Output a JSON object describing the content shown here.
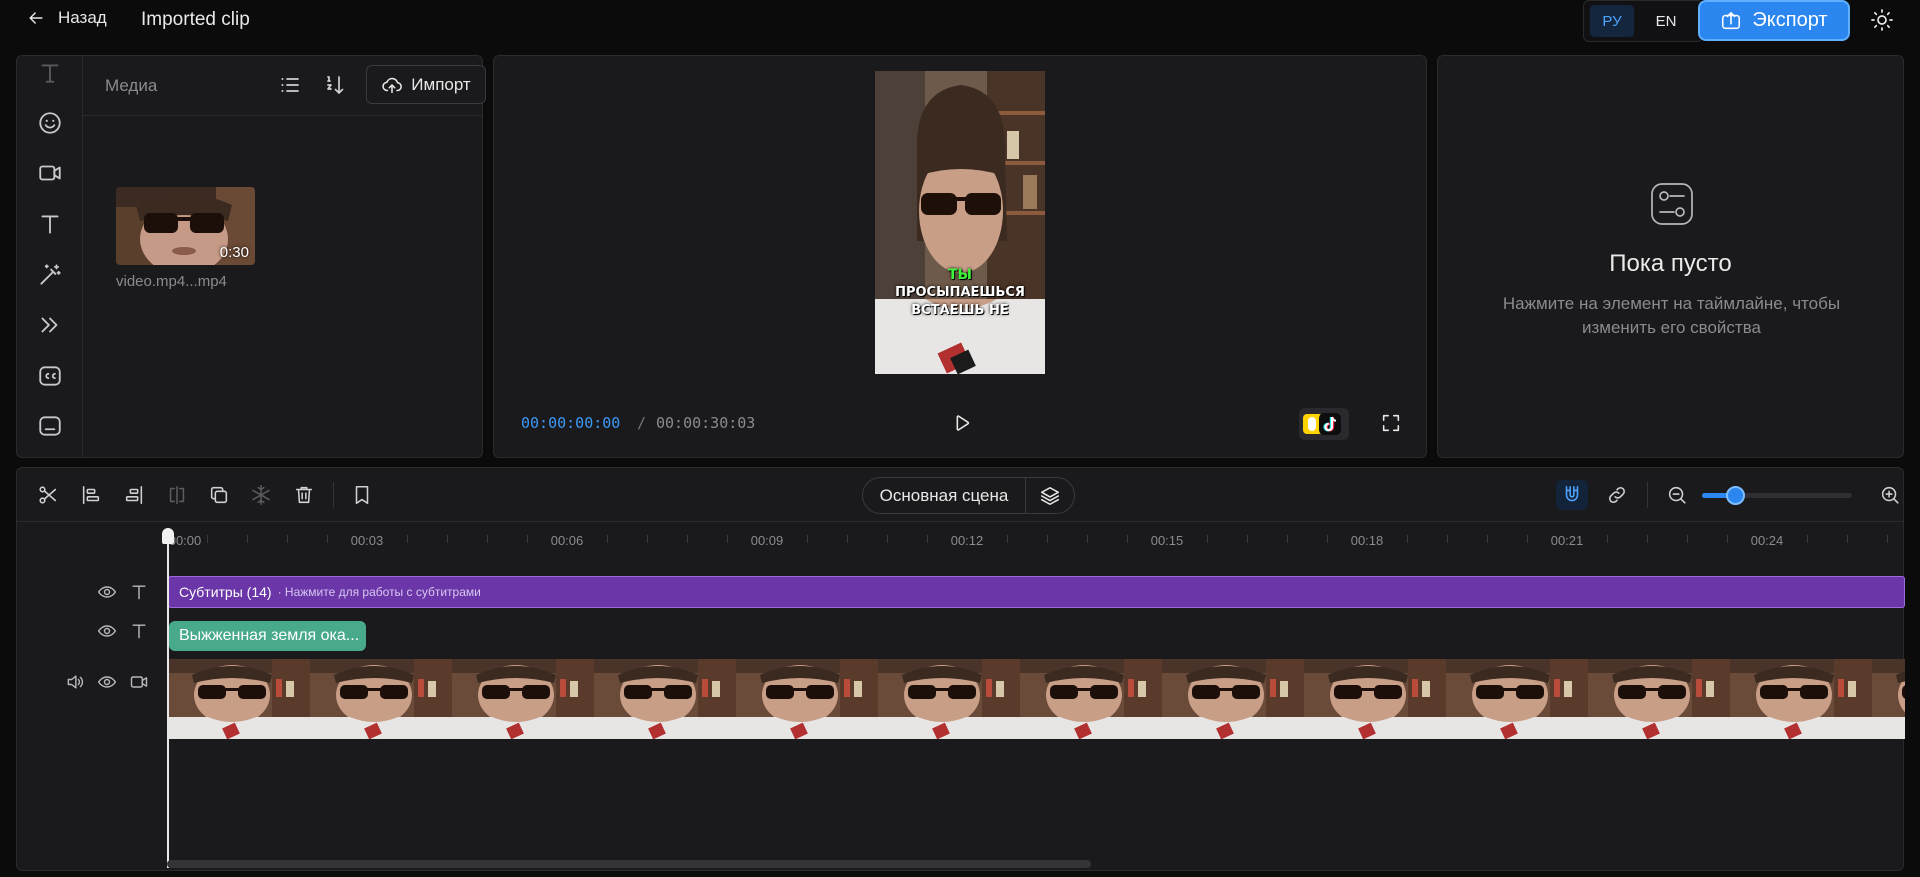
{
  "header": {
    "back_label": "Назад",
    "project_title": "Imported clip",
    "languages": [
      {
        "code": "РУ",
        "active": true
      },
      {
        "code": "EN",
        "active": false
      }
    ],
    "export_label": "Экспорт"
  },
  "media_panel": {
    "title": "Медиа",
    "import_label": "Импорт",
    "items": [
      {
        "name": "video.mp4...mp4",
        "duration": "0:30"
      }
    ]
  },
  "preview": {
    "caption_highlight": "ТЫ",
    "caption_line1": "ПРОСЫПАЕШЬСЯ",
    "caption_line2": "ВСТАЕШЬ НЕ",
    "current_time": "00:00:00:00",
    "separator": "/",
    "total_time": "00:00:30:03"
  },
  "properties": {
    "title": "Пока пусто",
    "hint": "Нажмите на элемент на таймлайне, чтобы изменить его свойства"
  },
  "timeline": {
    "scene_name": "Основная сцена",
    "zoom_level": 0.22,
    "ruler_labels": [
      "00:00",
      "00:03",
      "00:06",
      "00:09",
      "00:12",
      "00:15",
      "00:18",
      "00:21",
      "00:24"
    ],
    "subtitle_track": {
      "title": "Субтитры (14)",
      "hint": "· Нажмите для работы с субтитрами"
    },
    "text_clip": "Выжженная земля ока..."
  },
  "colors": {
    "accent": "#2b86ef",
    "subtitle_track": "#6a36a8",
    "text_clip": "#48a98d",
    "caption_highlight": "#3ff23a"
  }
}
